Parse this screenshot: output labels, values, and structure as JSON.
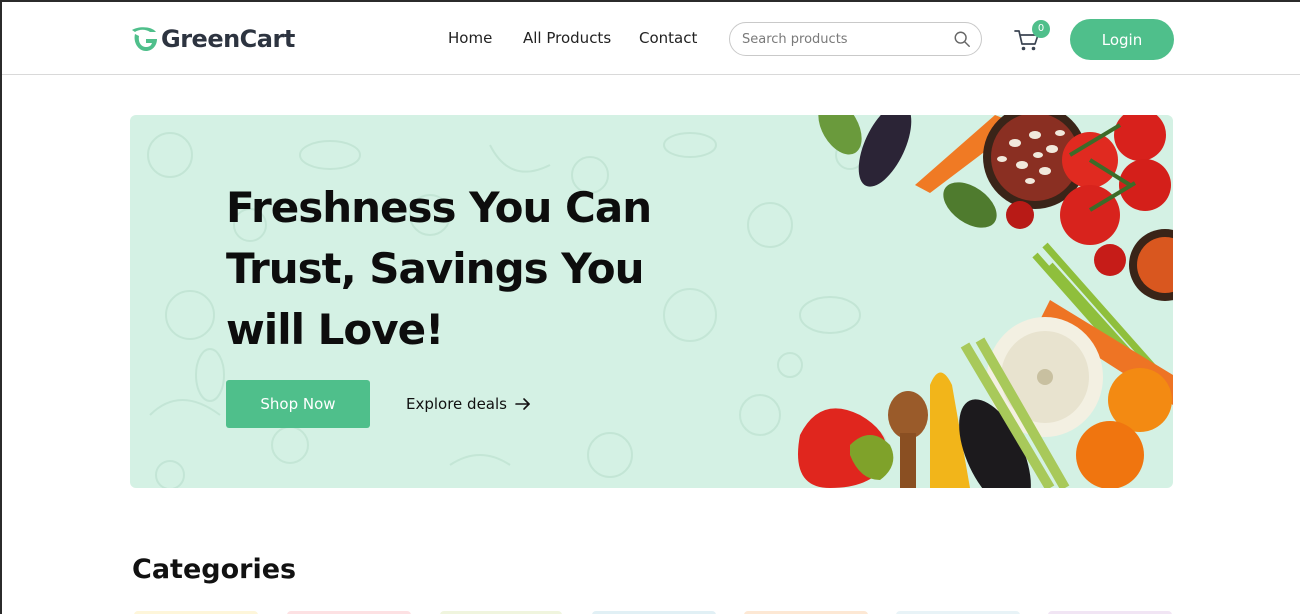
{
  "brand": {
    "name": "GreenCart",
    "accent": "#4fbf8b"
  },
  "nav": {
    "links": [
      "Home",
      "All Products",
      "Contact"
    ]
  },
  "search": {
    "placeholder": "Search products",
    "icon": "search-icon"
  },
  "cart": {
    "icon": "cart-icon",
    "count": "0"
  },
  "login_label": "Login",
  "hero": {
    "title": "Freshness You Can Trust, Savings You will Love!",
    "primary_cta": "Shop Now",
    "secondary_cta": "Explore deals",
    "secondary_icon": "arrow-right-icon",
    "background": "#d4f1e4"
  },
  "categories": {
    "title": "Categories",
    "tile_colors": [
      "#fef6da",
      "#fde1e3",
      "#f0f5de",
      "#e1f0f5",
      "#fde8d4",
      "#e8f3f7",
      "#f1e5f4"
    ]
  }
}
